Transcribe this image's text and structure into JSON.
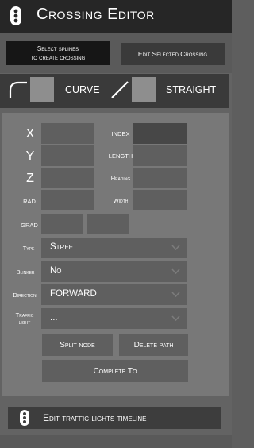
{
  "title": "Crossing Editor",
  "toolbar": {
    "select_label_line1": "Select splines",
    "select_label_line2": "to create crossing",
    "edit_label": "Edit Selected Crossing"
  },
  "modes": {
    "curve": "CURVE",
    "straight": "STRAIGHT"
  },
  "fields": {
    "x": "X",
    "y": "Y",
    "z": "Z",
    "rad": "RAD",
    "grad": "GRAD",
    "index": "INDEX",
    "length": "LENGTH",
    "heading": "Heading",
    "width": "Width"
  },
  "dropdowns": {
    "type_label": "Type",
    "type_value": "Street",
    "blinker_label": "Blinker",
    "blinker_value": "No",
    "direction_label": "Direction",
    "direction_value": "FORWARD",
    "traffic_label_line1": "Traffic",
    "traffic_label_line2": "light",
    "traffic_value": "..."
  },
  "actions": {
    "split": "Split node",
    "delete": "Delete path",
    "complete": "Complete To"
  },
  "timeline": "Edit traffic lights timeline"
}
